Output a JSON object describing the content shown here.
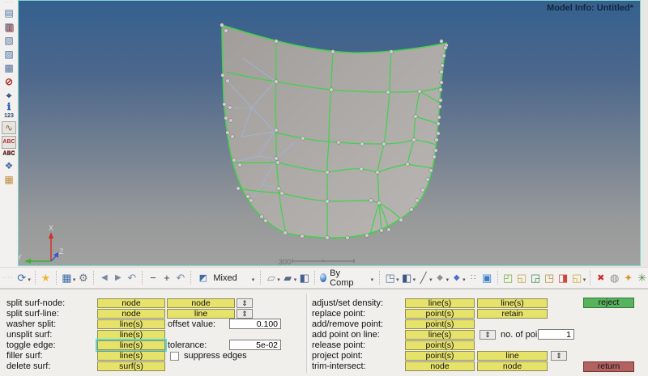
{
  "viewport": {
    "model_info": "Model Info: Untitled*",
    "scale_label": "300",
    "axis_x": "X",
    "axis_y": "Y",
    "axis_z": "Z"
  },
  "toolbar": {
    "mixed": "Mixed",
    "by_comp": "By Comp"
  },
  "icons": {
    "grip": "····",
    "session": "▤",
    "import": "▥",
    "export": "▧",
    "organize": "▨",
    "views": "▩",
    "no_entity": "⊘",
    "find": "⌖",
    "info": "ℹ",
    "numbers": "123",
    "plot": "∿",
    "abc": "ABC",
    "blocks": "❖",
    "section": "▦",
    "rotate": "⟳",
    "star": "★",
    "panels": "▦",
    "tool": "⚙",
    "prev": "◀",
    "next": "▶",
    "undo": "↶",
    "minus": "−",
    "plus": "+",
    "caret": "▾",
    "mixed_icon": "◩",
    "surf_wire": "▱",
    "surf_shade": "▰",
    "cube": "◧",
    "elem_wire": "◳",
    "elem_shade": "◧",
    "line": "╱",
    "diamond": "◆",
    "dots": "∷",
    "monitor": "▣",
    "mask1": "◰",
    "mask2": "◱",
    "mask3": "◲",
    "mask4": "◳",
    "mask5": "◨",
    "delete": "✖",
    "spheres": "◍",
    "flame": "✦",
    "tree": "✳",
    "spinner": "⇕"
  },
  "panel": {
    "left": {
      "rows": [
        {
          "label": "split surf-node:",
          "b1": "node",
          "b2": "node"
        },
        {
          "label": "split surf-line:",
          "b1": "node",
          "b2": "line"
        },
        {
          "label": "washer split:",
          "b1": "line(s)"
        },
        {
          "label": "unsplit surf:",
          "b1": "line(s)"
        },
        {
          "label": "toggle edge:",
          "b1": "line(s)"
        },
        {
          "label": "filler surf:",
          "b1": "line(s)"
        },
        {
          "label": "delete surf:",
          "b1": "surf(s)"
        }
      ],
      "offset_label": "offset value:",
      "offset_value": "0.100",
      "tolerance_label": "tolerance:",
      "tolerance_value": "5e-02",
      "suppress_label": "suppress edges"
    },
    "middle": {
      "rows": [
        {
          "label": "adjust/set density:",
          "b1": "line(s)",
          "b2": "line(s)"
        },
        {
          "label": "replace point:",
          "b1": "point(s)",
          "b2": "retain"
        },
        {
          "label": "add/remove point:",
          "b1": "point(s)"
        },
        {
          "label": "add point on line:",
          "b1": "line(s)"
        },
        {
          "label": "release point:",
          "b1": "point(s)"
        },
        {
          "label": "project point:",
          "b1": "point(s)",
          "b2": "line"
        },
        {
          "label": "trim-intersect:",
          "b1": "node",
          "b2": "node"
        }
      ],
      "points_label": "no. of points",
      "points_value": "1"
    },
    "actions": {
      "reject": "reject",
      "return": "return"
    }
  },
  "colors": {
    "edge_green": "#3fd34a",
    "suppressed_blue": "#9fb6da",
    "highlight_cyan": "#5ed8ca",
    "button_yellow": "#e6e26a",
    "reject_green": "#58b25e",
    "return_red": "#b26161",
    "viewport_top": "#35608e",
    "viewport_bottom": "#a1a19f"
  }
}
